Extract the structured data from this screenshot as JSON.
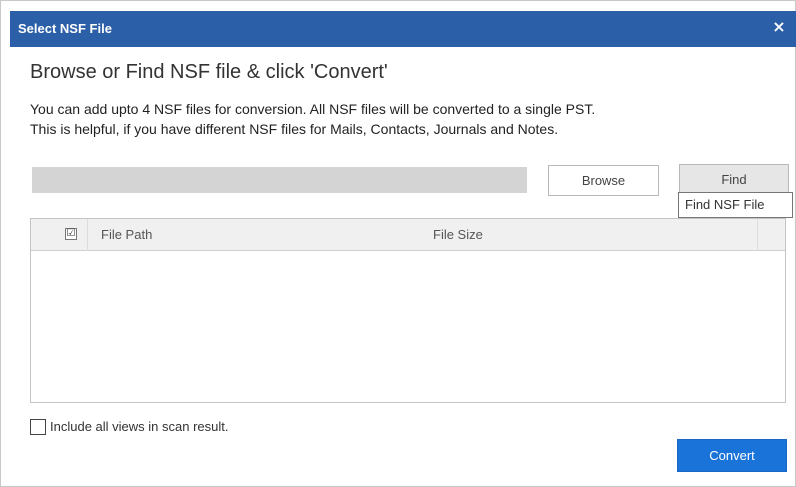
{
  "window": {
    "title": "Select NSF File",
    "close_glyph": "×"
  },
  "main": {
    "heading": "Browse or Find NSF file & click 'Convert'",
    "desc_line1": "You can add upto 4 NSF files for conversion. All NSF files will be converted to a single PST.",
    "desc_line2": "This is helpful, if you have different NSF files for Mails, Contacts, Journals and Notes.",
    "path_value": ""
  },
  "buttons": {
    "browse": "Browse",
    "find": "Find",
    "find_tooltip": "Find NSF File",
    "convert": "Convert"
  },
  "table": {
    "header_checked": "☑",
    "columns": [
      "File Path",
      "File Size"
    ],
    "rows": []
  },
  "options": {
    "include_views_label": "Include all views in scan result.",
    "include_views_checked": false
  },
  "colors": {
    "titlebar": "#2b5fa7",
    "convert_button": "#1a73d9"
  }
}
